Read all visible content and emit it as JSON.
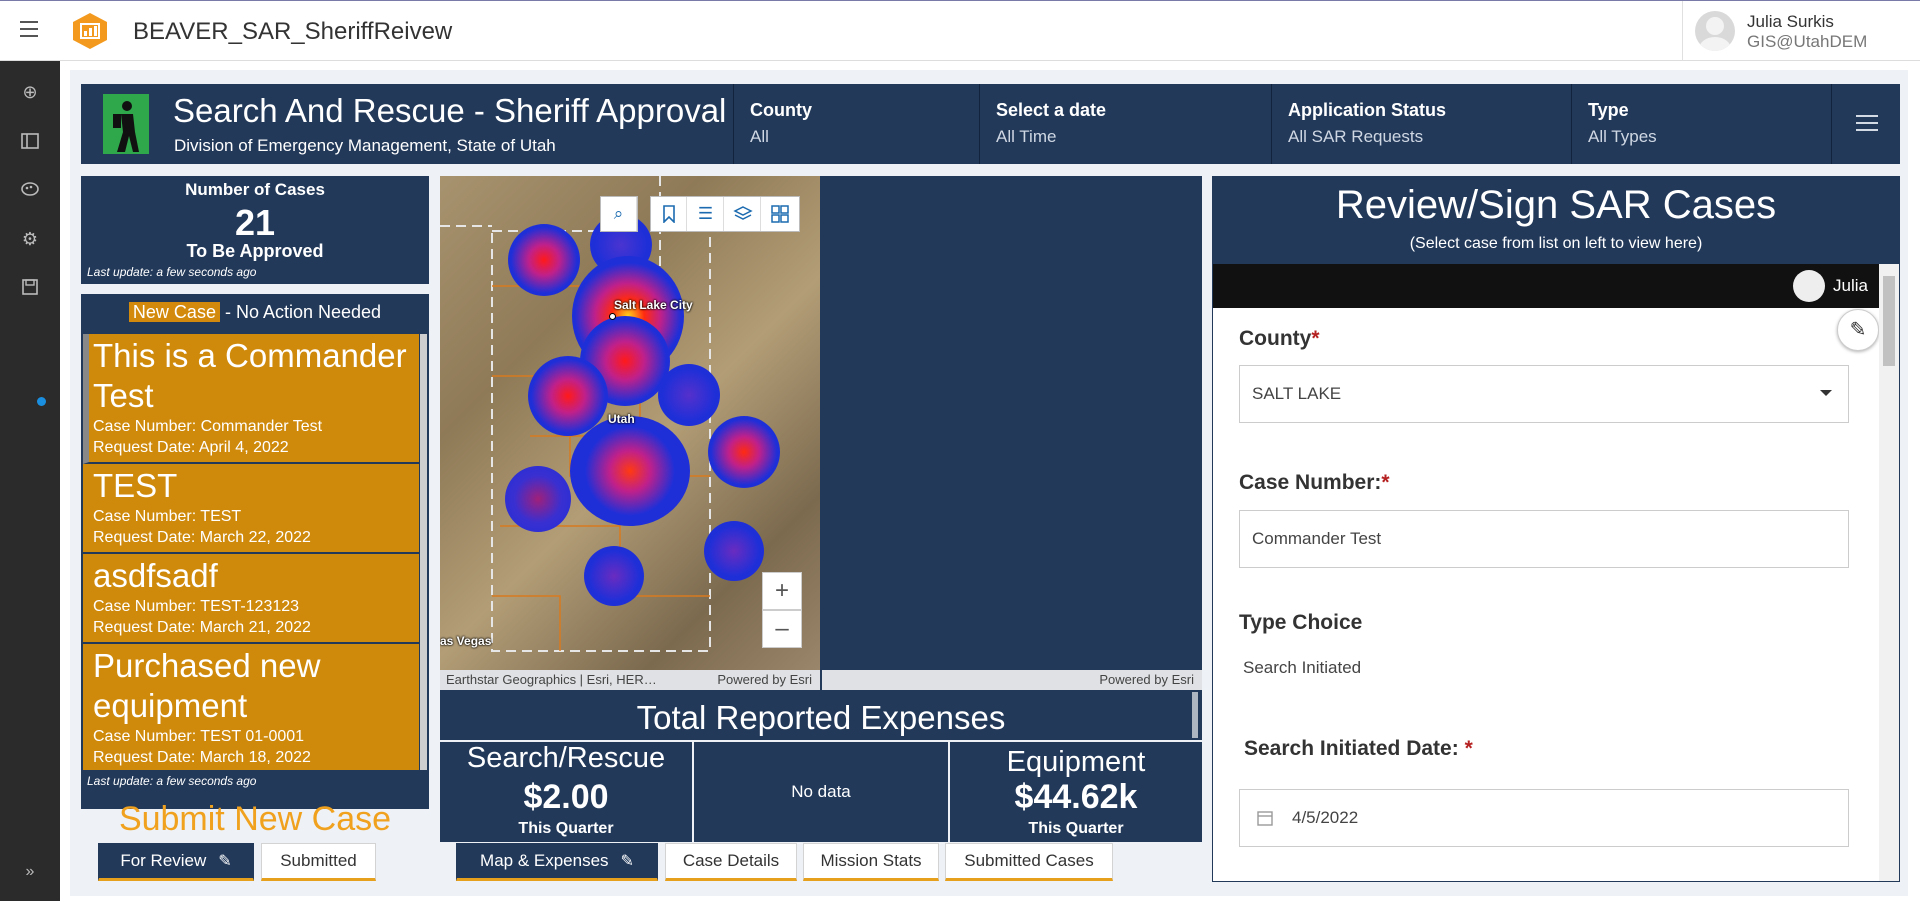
{
  "app": {
    "title": "BEAVER_SAR_SheriffReivew",
    "user_name": "Julia Surkis",
    "user_org": "GIS@UtahDEM"
  },
  "header": {
    "title": "Search And Rescue - Sheriff Approval",
    "subtitle": "Division of Emergency Management, State of Utah",
    "filters": [
      {
        "label": "County",
        "value": "All"
      },
      {
        "label": "Select a date",
        "value": "All Time"
      },
      {
        "label": "Application Status",
        "value": "All SAR Requests"
      },
      {
        "label": "Type",
        "value": "All Types"
      }
    ]
  },
  "indicator": {
    "title": "Number of Cases",
    "value": "21",
    "bottom": "To Be Approved",
    "last_update": "Last update: a few seconds ago"
  },
  "case_list": {
    "badge": "New Case",
    "header_rest": " - No Action Needed",
    "items": [
      {
        "title": "This is a Commander Test",
        "case_number": "Case Number: Commander Test",
        "request_date": "Request Date: April 4, 2022"
      },
      {
        "title": "TEST",
        "case_number": "Case Number: TEST",
        "request_date": "Request Date: March 22, 2022"
      },
      {
        "title": "asdfsadf",
        "case_number": "Case Number: TEST-123123",
        "request_date": "Request Date: March 21, 2022"
      },
      {
        "title": "Purchased new equipment",
        "case_number": "Case Number: TEST 01-0001",
        "request_date": "Request Date: March 18, 2022"
      }
    ],
    "last_update": "Last update: a few seconds ago",
    "submit_label": "Submit New Case"
  },
  "tabs_left": [
    {
      "label": "For Review"
    },
    {
      "label": "Submitted"
    }
  ],
  "tabs_center": [
    {
      "label": "Map & Expenses"
    },
    {
      "label": "Case Details"
    },
    {
      "label": "Mission Stats"
    },
    {
      "label": "Submitted Cases"
    }
  ],
  "map": {
    "labels": {
      "city": "Salt Lake City",
      "state": "Utah",
      "vegas": "as Vegas"
    },
    "attribution_left": "Earthstar Geographics | Esri, HER…",
    "powered_left": "Powered by Esri",
    "powered_right": "Powered by Esri",
    "icons": [
      "search-icon",
      "bookmark-icon",
      "legend-list-icon",
      "layers-icon",
      "basemap-gallery-icon"
    ]
  },
  "expenses": {
    "title": "Total Reported Expenses",
    "boxes": [
      {
        "name": "Search/Rescue",
        "value": "$2.00",
        "sub": "This Quarter"
      },
      {
        "name": "No data"
      },
      {
        "name": "Equipment",
        "value": "$44.62k",
        "sub": "This Quarter"
      }
    ]
  },
  "review": {
    "title": "Review/Sign SAR Cases",
    "subtitle": "(Select case from list on left to view here)",
    "user": "Julia",
    "county_label": "County",
    "county_value": "SALT LAKE",
    "case_number_label": "Case Number:",
    "case_number_value": "Commander Test",
    "type_choice_label": "Type Choice",
    "type_choice_value": "Search Initiated",
    "search_date_label": "Search Initiated Date: ",
    "search_date_value": "4/5/2022"
  },
  "colors": {
    "panel": "#22395a",
    "case_item": "#cf8a0c",
    "accent": "#e6a01c"
  }
}
